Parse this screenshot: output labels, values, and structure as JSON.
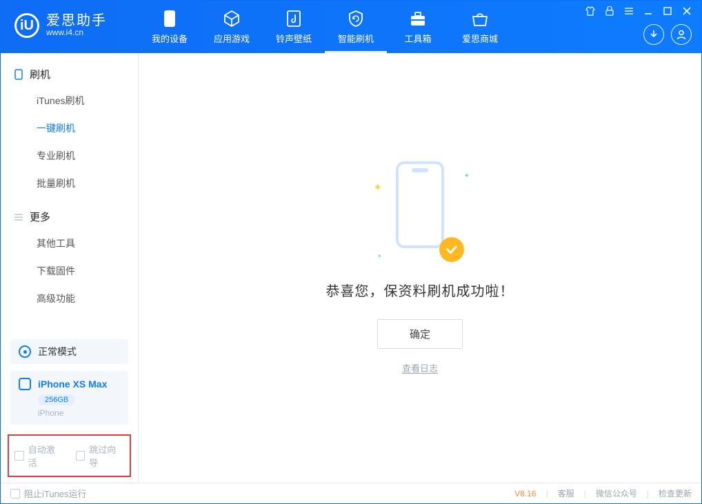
{
  "app": {
    "name": "爱思助手",
    "url": "www.i4.cn"
  },
  "nav": {
    "tabs": [
      {
        "label": "我的设备"
      },
      {
        "label": "应用游戏"
      },
      {
        "label": "铃声壁纸"
      },
      {
        "label": "智能刷机"
      },
      {
        "label": "工具箱"
      },
      {
        "label": "爱思商城"
      }
    ]
  },
  "sidebar": {
    "groups": [
      {
        "title": "刷机",
        "items": [
          {
            "label": "iTunes刷机"
          },
          {
            "label": "一键刷机"
          },
          {
            "label": "专业刷机"
          },
          {
            "label": "批量刷机"
          }
        ]
      },
      {
        "title": "更多",
        "items": [
          {
            "label": "其他工具"
          },
          {
            "label": "下载固件"
          },
          {
            "label": "高级功能"
          }
        ]
      }
    ],
    "mode": "正常模式",
    "device": {
      "name": "iPhone XS Max",
      "capacity": "256GB",
      "type": "iPhone"
    },
    "checks": {
      "auto_activate": "自动激活",
      "skip_guide": "跳过向导"
    }
  },
  "main": {
    "success": "恭喜您，保资料刷机成功啦！",
    "ok": "确定",
    "view_log": "查看日志"
  },
  "footer": {
    "block_itunes": "阻止iTunes运行",
    "version": "V8.16",
    "support": "客服",
    "wechat": "微信公众号",
    "check_update": "检查更新"
  }
}
